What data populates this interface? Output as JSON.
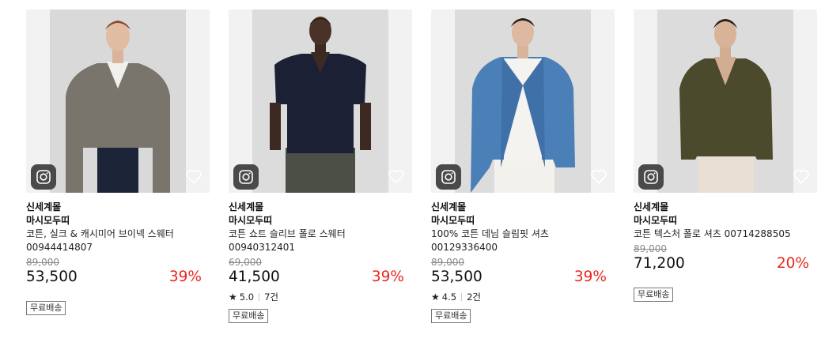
{
  "products": [
    {
      "store": "신세계몰",
      "brand": "마시모두띠",
      "name": "코튼, 실크 & 캐시미어 브이넥 스웨터 00944414807",
      "original_price": "89,000",
      "price": "53,500",
      "discount": "39%",
      "rating": null,
      "review_count": null,
      "badge": "무료배송",
      "garment_color": "#7a756c"
    },
    {
      "store": "신세계몰",
      "brand": "마시모두띠",
      "name": "코튼 쇼트 슬리브 폴로 스웨터 00940312401",
      "original_price": "69,000",
      "price": "41,500",
      "discount": "39%",
      "rating": "5.0",
      "review_count": "7건",
      "badge": "무료배송",
      "garment_color": "#1b2035"
    },
    {
      "store": "신세계몰",
      "brand": "마시모두띠",
      "name": "100% 코튼 데님 슬림핏 셔츠 00129336400",
      "original_price": "89,000",
      "price": "53,500",
      "discount": "39%",
      "rating": "4.5",
      "review_count": "2건",
      "badge": "무료배송",
      "garment_color": "#4a7fb8"
    },
    {
      "store": "신세계몰",
      "brand": "마시모두띠",
      "name": "코튼 텍스처 폴로 셔츠 00714288505",
      "original_price": "89,000",
      "price": "71,200",
      "discount": "20%",
      "rating": null,
      "review_count": null,
      "badge": "무료배송",
      "garment_color": "#4b4a2c"
    }
  ],
  "icons": {
    "instagram": "instagram-icon",
    "wishlist": "heart-icon",
    "rating": "star-icon"
  },
  "colors": {
    "discount": "#e8281f",
    "original_price": "#8a8a8a",
    "icon_badge": "#4a4a4a"
  }
}
